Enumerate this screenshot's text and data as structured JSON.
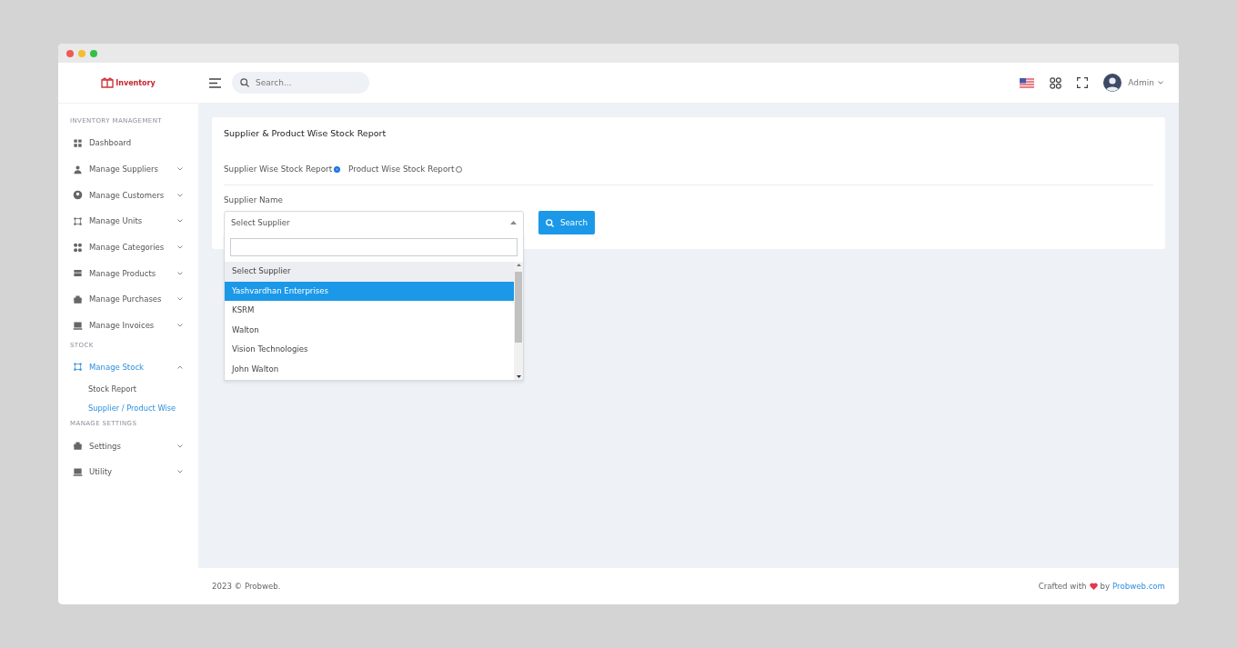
{
  "header": {
    "logo": "Inventory",
    "search": {
      "placeholder": "Search..."
    },
    "user": "Admin"
  },
  "sidebar": {
    "sections": [
      {
        "heading": "INVENTORY MANAGEMENT",
        "items": [
          {
            "label": "Dashboard",
            "selected": false
          },
          {
            "label": "Manage Suppliers",
            "selected": false,
            "expanded": false
          },
          {
            "label": "Manage Customers",
            "selected": false,
            "expanded": false
          },
          {
            "label": "Manage Units",
            "selected": false,
            "expanded": false
          },
          {
            "label": "Manage Categories",
            "selected": false,
            "expanded": false
          },
          {
            "label": "Manage Products",
            "selected": false,
            "expanded": false
          },
          {
            "label": "Manage Purchases",
            "selected": false,
            "expanded": false
          },
          {
            "label": "Manage Invoices",
            "selected": false,
            "expanded": false
          }
        ]
      },
      {
        "heading": "STOCK",
        "items": [
          {
            "label": "Manage Stock",
            "selected": true,
            "expanded": true,
            "children": [
              {
                "label": "Stock Report",
                "selected": false
              },
              {
                "label": "Supplier / Product Wise",
                "selected": true
              }
            ]
          }
        ]
      },
      {
        "heading": "MANAGE SETTINGS",
        "items": [
          {
            "label": "Settings",
            "selected": false,
            "expanded": false
          },
          {
            "label": "Utility",
            "selected": false,
            "expanded": false
          }
        ]
      }
    ]
  },
  "card": {
    "title": "Supplier & Product Wise Stock Report",
    "report_types": [
      {
        "label": "Supplier Wise Stock Report",
        "selected": true
      },
      {
        "label": "Product Wise Stock Report",
        "selected": false
      }
    ],
    "field_label": "Supplier Name",
    "select": {
      "value": "Select Supplier",
      "expanded": true,
      "options": [
        {
          "label": "Select Supplier",
          "selected": true,
          "highlighted": false
        },
        {
          "label": "Yashvardhan Enterprises",
          "selected": false,
          "highlighted": true
        },
        {
          "label": "KSRM",
          "selected": false,
          "highlighted": false
        },
        {
          "label": "Walton",
          "selected": false,
          "highlighted": false
        },
        {
          "label": "Vision Technologies",
          "selected": false,
          "highlighted": false
        },
        {
          "label": "John Walton",
          "selected": false,
          "highlighted": false
        }
      ]
    },
    "button": "Search"
  },
  "footer": {
    "copyright": "2023 © Probweb.",
    "crafted": "Crafted with",
    "by": "by",
    "link": "Probweb.com"
  }
}
